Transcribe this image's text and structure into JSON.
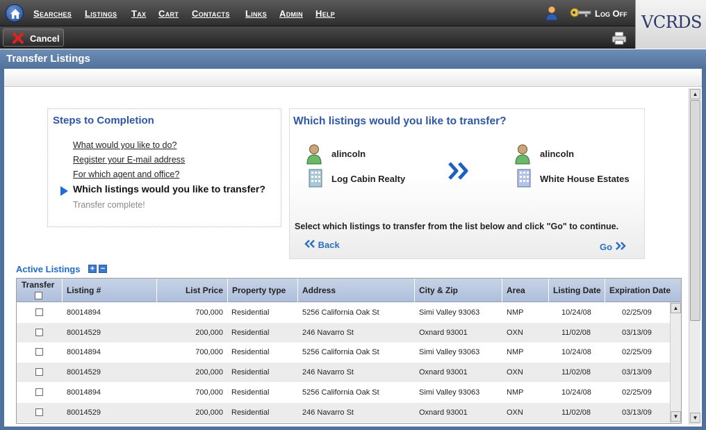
{
  "nav": {
    "items": [
      "Searches",
      "Listings",
      "Tax",
      "Cart",
      "Contacts",
      "Links",
      "Admin",
      "Help"
    ],
    "logoff": "Log Off",
    "logo": "VCRDS"
  },
  "toolbar": {
    "cancel_label": "Cancel"
  },
  "page": {
    "title": "Transfer Listings"
  },
  "steps": {
    "title": "Steps to Completion",
    "items": [
      "What would you like to do?",
      "Register your E-mail address",
      "For which agent and office?",
      "Which listings would you like to transfer?",
      "Transfer complete!"
    ]
  },
  "transfer": {
    "title": "Which listings would you like to transfer?",
    "from_user": "alincoln",
    "from_office": "Log Cabin Realty",
    "to_user": "alincoln",
    "to_office": "White House Estates",
    "instruction": "Select which listings to transfer from the list below and click \"Go\" to continue.",
    "back_label": "Back",
    "go_label": "Go"
  },
  "listings": {
    "title": "Active Listings",
    "columns": [
      "Transfer",
      "Listing #",
      "List Price",
      "Property type",
      "Address",
      "City & Zip",
      "Area",
      "Listing Date",
      "Expiration Date"
    ],
    "rows": [
      [
        "80014894",
        "700,000",
        "Residential",
        "5256 California Oak St",
        "Simi Valley 93063",
        "NMP",
        "10/24/08",
        "02/25/09"
      ],
      [
        "80014529",
        "200,000",
        "Residential",
        "246 Navarro St",
        "Oxnard 93001",
        "OXN",
        "11/02/08",
        "03/13/09"
      ],
      [
        "80014894",
        "700,000",
        "Residential",
        "5256 California Oak St",
        "Simi Valley 93063",
        "NMP",
        "10/24/08",
        "02/25/09"
      ],
      [
        "80014529",
        "200,000",
        "Residential",
        "246 Navarro St",
        "Oxnard 93001",
        "OXN",
        "11/02/08",
        "03/13/09"
      ],
      [
        "80014894",
        "700,000",
        "Residential",
        "5256 California Oak St",
        "Simi Valley 93063",
        "NMP",
        "10/24/08",
        "02/25/09"
      ],
      [
        "80014529",
        "200,000",
        "Residential",
        "246 Navarro St",
        "Oxnard 93001",
        "OXN",
        "11/02/08",
        "03/13/09"
      ]
    ]
  },
  "icons": {
    "home": "home-icon",
    "user": "user-icon",
    "key": "key-icon",
    "cancel": "red-x-icon",
    "printer": "printer-icon",
    "building": "building-icon",
    "double_arrow": "double-chevron-right-icon"
  },
  "colors": {
    "accent_blue": "#2e56a4",
    "link_blue": "#2e6fbd",
    "header_blue": "#4f719b"
  }
}
